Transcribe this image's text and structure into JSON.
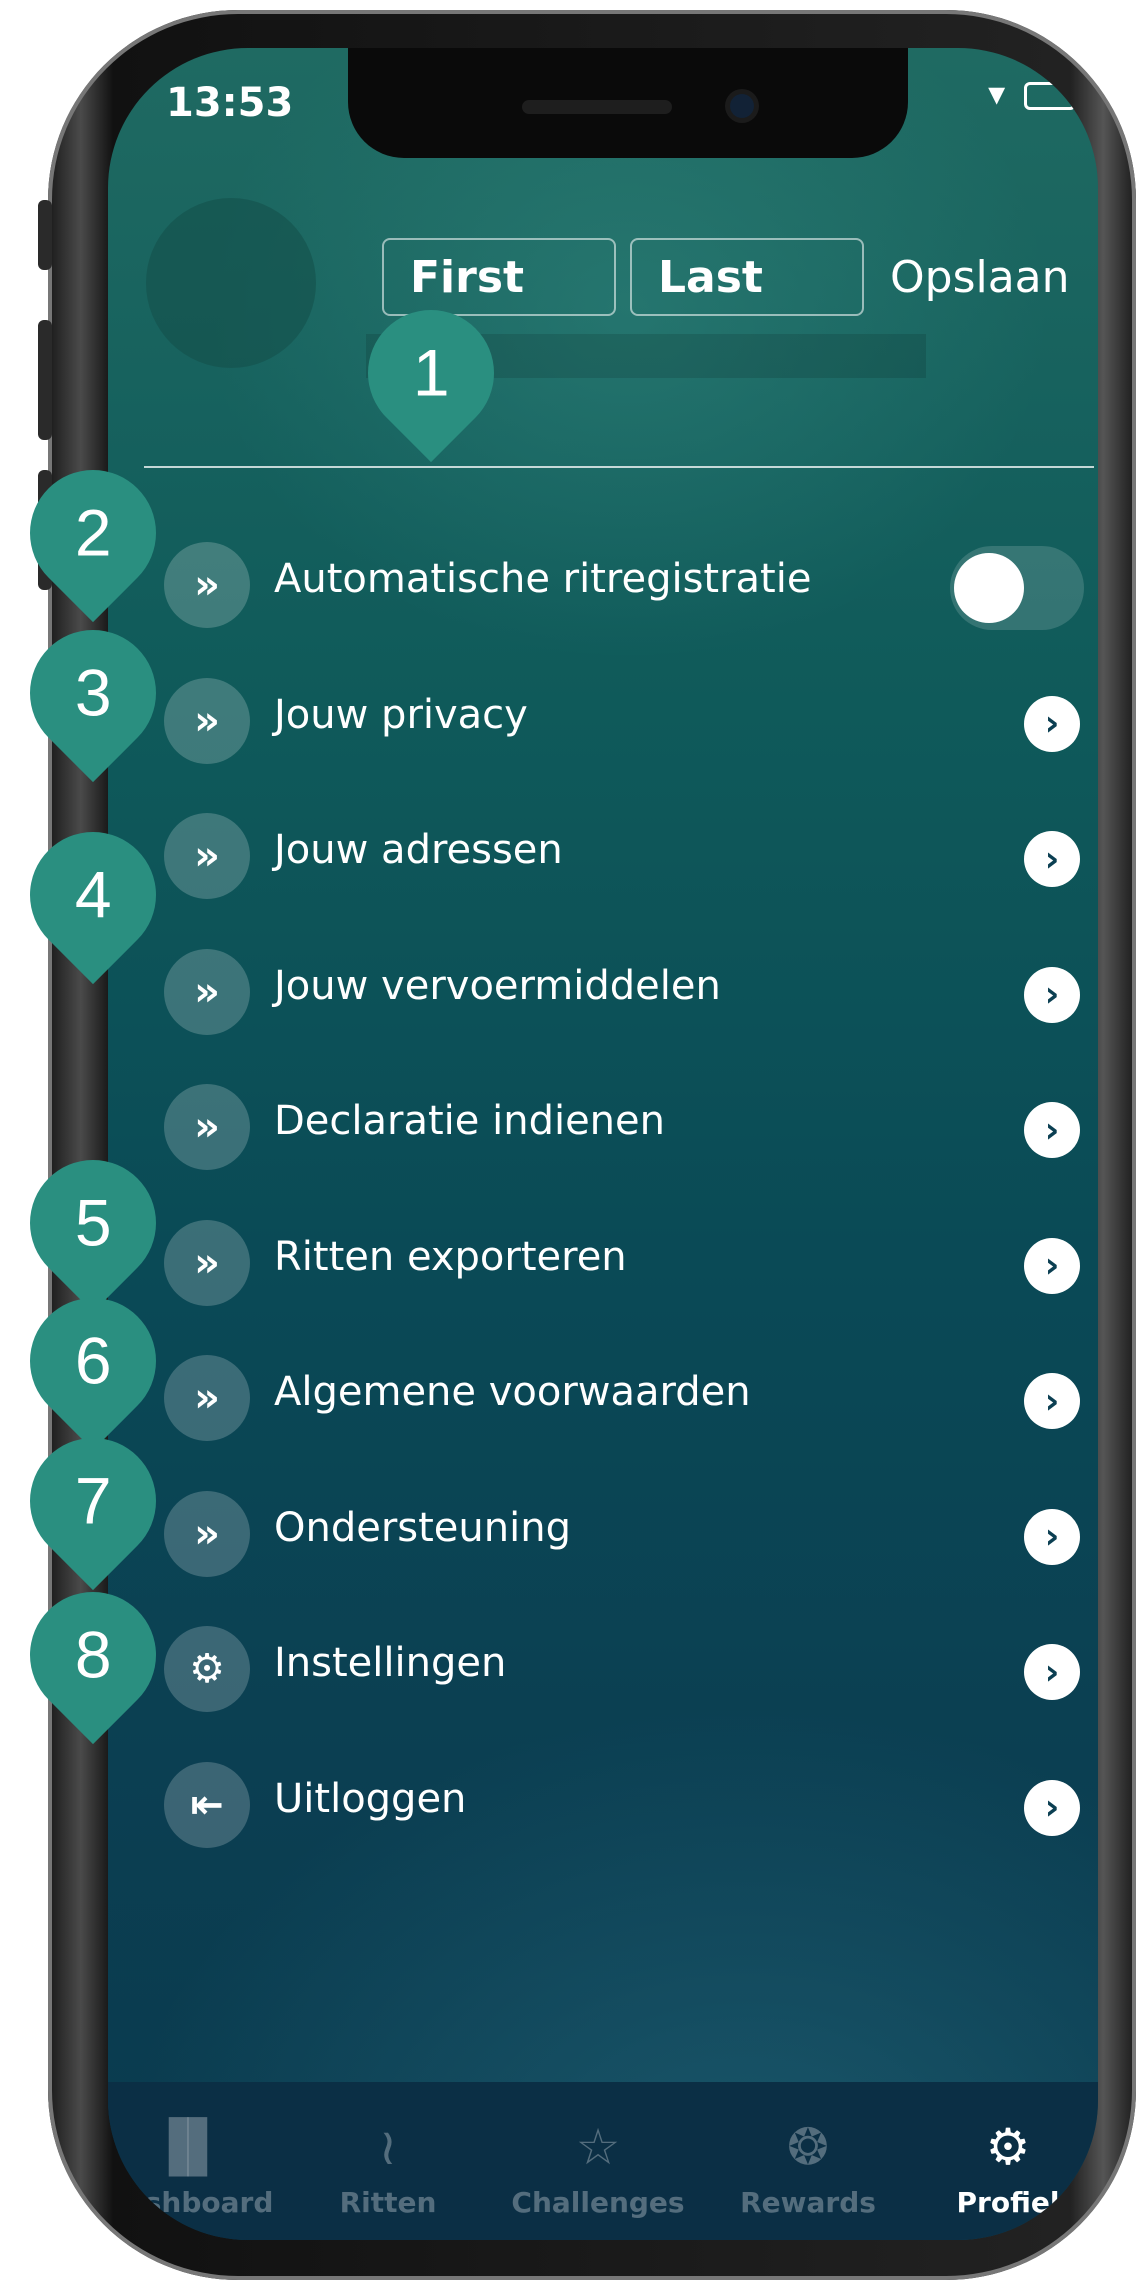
{
  "status_bar": {
    "time": "13:53"
  },
  "profile": {
    "first_name": "First",
    "last_name": "Last",
    "save_label": "Opslaan"
  },
  "menu": [
    {
      "label": "Automatische ritregistratie",
      "icon": "chevrons-right-icon",
      "control": "toggle",
      "toggle_on": false
    },
    {
      "label": "Jouw privacy",
      "icon": "chevrons-right-icon",
      "control": "chevron"
    },
    {
      "label": "Jouw adressen",
      "icon": "chevrons-right-icon",
      "control": "chevron"
    },
    {
      "label": "Jouw vervoermiddelen",
      "icon": "chevrons-right-icon",
      "control": "chevron"
    },
    {
      "label": "Declaratie indienen",
      "icon": "chevrons-right-icon",
      "control": "chevron"
    },
    {
      "label": "Ritten exporteren",
      "icon": "chevrons-right-icon",
      "control": "chevron"
    },
    {
      "label": "Algemene voorwaarden",
      "icon": "chevrons-right-icon",
      "control": "chevron"
    },
    {
      "label": "Ondersteuning",
      "icon": "chevrons-right-icon",
      "control": "chevron"
    },
    {
      "label": "Instellingen",
      "icon": "gear-icon",
      "control": "chevron"
    },
    {
      "label": "Uitloggen",
      "icon": "logout-icon",
      "control": "chevron"
    }
  ],
  "tabs": [
    {
      "label": "Dashboard",
      "icon": "footsteps-icon",
      "active": false
    },
    {
      "label": "Ritten",
      "icon": "route-icon",
      "active": false
    },
    {
      "label": "Challenges",
      "icon": "trophy-icon",
      "active": false
    },
    {
      "label": "Rewards",
      "icon": "medal-icon",
      "active": false
    },
    {
      "label": "Profiel",
      "icon": "gears-icon",
      "active": true
    }
  ],
  "annotations": [
    "1",
    "2",
    "3",
    "4",
    "5",
    "6",
    "7",
    "8"
  ],
  "colors": {
    "badge": "#2a8f80",
    "tabbar": "#0b2f45",
    "background_top": "#1f6a62",
    "background_bottom": "#0a3a4e"
  }
}
